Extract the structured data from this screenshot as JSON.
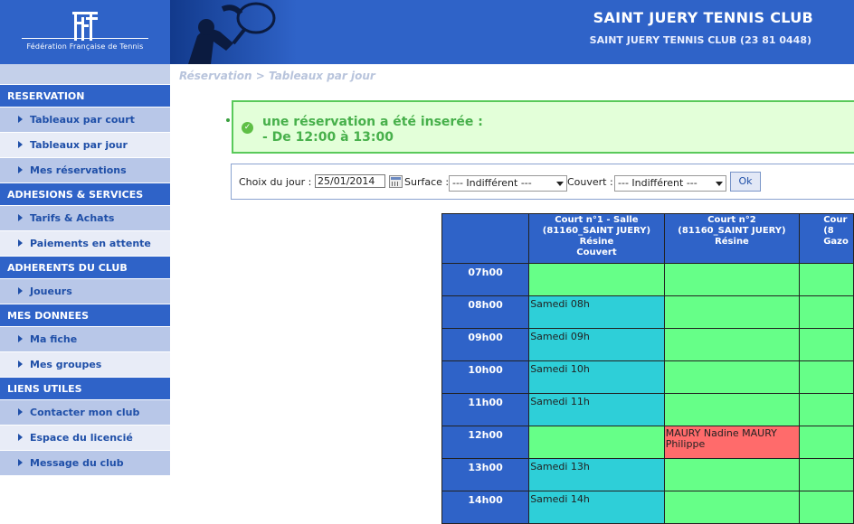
{
  "header": {
    "fft_caption": "Fédération Française de Tennis",
    "club_title": "SAINT JUERY TENNIS CLUB",
    "club_subtitle": "SAINT JUERY TENNIS CLUB (23 81 0448)"
  },
  "sidebar": {
    "sections": [
      {
        "title": "RESERVATION",
        "items": [
          "Tableaux par court",
          "Tableaux par jour",
          "Mes réservations"
        ]
      },
      {
        "title": "ADHESIONS & SERVICES",
        "items": [
          "Tarifs & Achats",
          "Paiements en attente"
        ]
      },
      {
        "title": "ADHERENTS DU CLUB",
        "items": [
          "Joueurs"
        ]
      },
      {
        "title": "MES DONNEES",
        "items": [
          "Ma fiche",
          "Mes groupes"
        ]
      },
      {
        "title": "LIENS UTILES",
        "items": [
          "Contacter mon club",
          "Espace du licencié",
          "Message du club"
        ]
      }
    ]
  },
  "breadcrumb": "Réservation > Tableaux par jour",
  "notice": {
    "line1": "une réservation a été inserée :",
    "line2": "- De 12:00 à 13:00"
  },
  "filter": {
    "day_label": "Choix du jour :",
    "day_value": "25/01/2014",
    "surface_label": "Surface :",
    "surface_value": "--- Indifférent ---",
    "covered_label": "Couvert :",
    "covered_value": "--- Indifférent ---",
    "ok_label": "Ok"
  },
  "courts": [
    {
      "lines": [
        "Court n°1 - Salle",
        "(81160_SAINT JUERY)",
        "Résine",
        "Couvert"
      ]
    },
    {
      "lines": [
        "Court n°2",
        "(81160_SAINT JUERY)",
        "Résine"
      ]
    },
    {
      "lines": [
        "Cour",
        "(8",
        "Gazo"
      ]
    }
  ],
  "hours": [
    {
      "label": "07h00",
      "cells": [
        {
          "state": "free",
          "text": ""
        },
        {
          "state": "free",
          "text": ""
        },
        {
          "state": "free",
          "text": ""
        }
      ]
    },
    {
      "label": "08h00",
      "cells": [
        {
          "state": "slot",
          "text": "Samedi 08h"
        },
        {
          "state": "free",
          "text": ""
        },
        {
          "state": "free",
          "text": ""
        }
      ]
    },
    {
      "label": "09h00",
      "cells": [
        {
          "state": "slot",
          "text": "Samedi 09h"
        },
        {
          "state": "free",
          "text": ""
        },
        {
          "state": "free",
          "text": ""
        }
      ]
    },
    {
      "label": "10h00",
      "cells": [
        {
          "state": "slot",
          "text": "Samedi 10h"
        },
        {
          "state": "free",
          "text": ""
        },
        {
          "state": "free",
          "text": ""
        }
      ]
    },
    {
      "label": "11h00",
      "cells": [
        {
          "state": "slot",
          "text": "Samedi 11h"
        },
        {
          "state": "free",
          "text": ""
        },
        {
          "state": "free",
          "text": ""
        }
      ]
    },
    {
      "label": "12h00",
      "cells": [
        {
          "state": "free",
          "text": ""
        },
        {
          "state": "booked",
          "text": "MAURY Nadine MAURY Philippe"
        },
        {
          "state": "free",
          "text": ""
        }
      ]
    },
    {
      "label": "13h00",
      "cells": [
        {
          "state": "slot",
          "text": "Samedi 13h"
        },
        {
          "state": "free",
          "text": ""
        },
        {
          "state": "free",
          "text": ""
        }
      ]
    },
    {
      "label": "14h00",
      "cells": [
        {
          "state": "slot",
          "text": "Samedi 14h"
        },
        {
          "state": "free",
          "text": ""
        },
        {
          "state": "free",
          "text": ""
        }
      ]
    }
  ],
  "colors": {
    "header_blue": "#2f63c8",
    "free_green": "#66ff88",
    "slot_cyan": "#2ecfd8",
    "booked_red": "#ff6b6b"
  }
}
